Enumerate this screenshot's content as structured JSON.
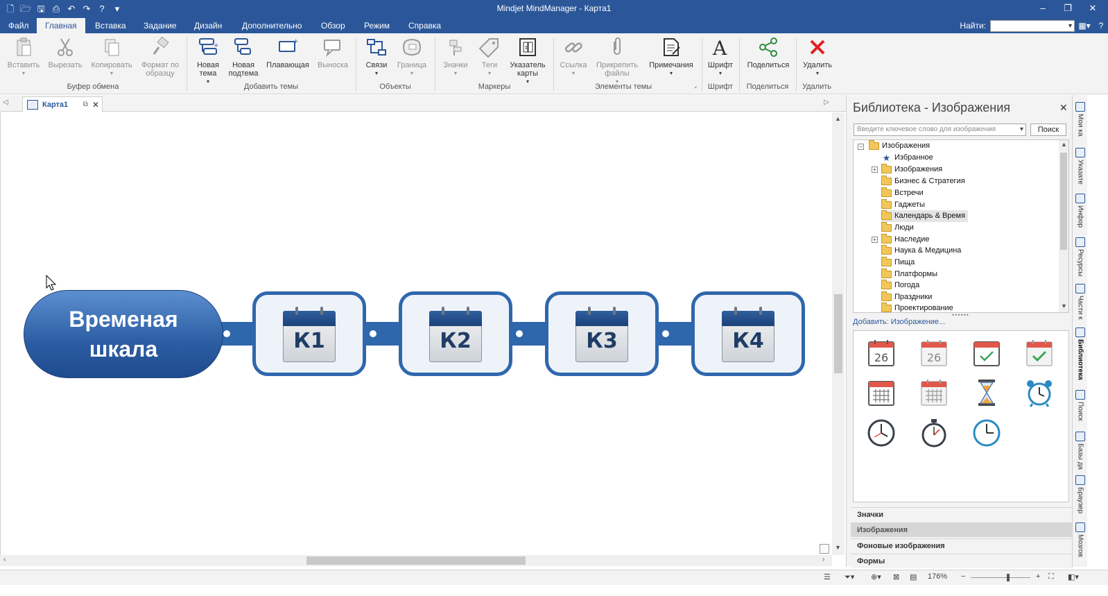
{
  "window": {
    "title": "Mindjet MindManager - Карта1",
    "qat_icons": [
      "new-doc-icon",
      "open-icon",
      "save-icon",
      "print-icon",
      "undo-icon",
      "redo-icon",
      "help-icon",
      "customize-icon"
    ]
  },
  "ribbon_tabs": [
    {
      "label": "Файл",
      "active": false
    },
    {
      "label": "Главная",
      "active": true
    },
    {
      "label": "Вставка",
      "active": false
    },
    {
      "label": "Задание",
      "active": false
    },
    {
      "label": "Дизайн",
      "active": false
    },
    {
      "label": "Дополнительно",
      "active": false
    },
    {
      "label": "Обзор",
      "active": false
    },
    {
      "label": "Режим",
      "active": false
    },
    {
      "label": "Справка",
      "active": false
    }
  ],
  "find": {
    "label": "Найти:",
    "value": ""
  },
  "ribbon": {
    "clipboard": {
      "label": "Буфер обмена",
      "paste": "Вставить",
      "cut": "Вырезать",
      "copy": "Копировать",
      "format_painter": "Формат по образцу"
    },
    "add_topics": {
      "label": "Добавить темы",
      "new_topic": "Новая тема",
      "new_subtopic": "Новая подтема",
      "floating": "Плавающая",
      "callout": "Выноска"
    },
    "objects": {
      "label": "Объекты",
      "relations": "Связи",
      "boundary": "Граница"
    },
    "markers": {
      "label": "Маркеры",
      "icons": "Значки",
      "tags": "Теги",
      "map_index": "Указатель карты"
    },
    "topic_elements": {
      "label": "Элементы темы",
      "link": "Ссылка",
      "attach": "Прикрепить файлы",
      "notes": "Примечания"
    },
    "font": {
      "label": "Шрифт",
      "font": "Шрифт"
    },
    "share": {
      "label": "Поделиться",
      "share": "Поделиться"
    },
    "delete": {
      "label": "Удалить",
      "delete": "Удалить"
    }
  },
  "doc_tab": {
    "label": "Карта1"
  },
  "map": {
    "central_topic": "Временая шкала",
    "subtopics": [
      "К1",
      "К2",
      "К3",
      "К4"
    ]
  },
  "panel": {
    "title": "Библиотека - Изображения",
    "search_placeholder": "Введите ключевое слово для изображения",
    "search_button": "Поиск",
    "tree": [
      {
        "label": "Изображения",
        "level": 0,
        "icon": "folder-open-icon",
        "expander": "⊟"
      },
      {
        "label": "Избранное",
        "level": 1,
        "icon": "star-icon",
        "expander": ""
      },
      {
        "label": "Изображения",
        "level": 1,
        "icon": "folder-icon",
        "expander": "⊞"
      },
      {
        "label": "Бизнес & Стратегия",
        "level": 1,
        "icon": "folder-icon",
        "expander": ""
      },
      {
        "label": "Встречи",
        "level": 1,
        "icon": "folder-icon",
        "expander": ""
      },
      {
        "label": "Гаджеты",
        "level": 1,
        "icon": "folder-icon",
        "expander": ""
      },
      {
        "label": "Календарь & Время",
        "level": 1,
        "icon": "folder-open-icon",
        "expander": "",
        "selected": true
      },
      {
        "label": "Люди",
        "level": 1,
        "icon": "folder-icon",
        "expander": ""
      },
      {
        "label": "Наследие",
        "level": 1,
        "icon": "folder-icon",
        "expander": "⊞"
      },
      {
        "label": "Наука & Медицина",
        "level": 1,
        "icon": "folder-icon",
        "expander": ""
      },
      {
        "label": "Пища",
        "level": 1,
        "icon": "folder-icon",
        "expander": ""
      },
      {
        "label": "Платформы",
        "level": 1,
        "icon": "folder-icon",
        "expander": ""
      },
      {
        "label": "Погода",
        "level": 1,
        "icon": "folder-icon",
        "expander": ""
      },
      {
        "label": "Праздники",
        "level": 1,
        "icon": "folder-icon",
        "expander": ""
      },
      {
        "label": "Проектирование",
        "level": 1,
        "icon": "folder-icon",
        "expander": ""
      }
    ],
    "add_link": "Добавить: Изображение...",
    "gallery": [
      {
        "icon": "calendar-day-icon",
        "text": "26"
      },
      {
        "icon": "calendar-day-light-icon",
        "text": "26"
      },
      {
        "icon": "calendar-check-icon",
        "text": ""
      },
      {
        "icon": "calendar-check-light-icon",
        "text": ""
      },
      {
        "icon": "calendar-grid-icon",
        "text": ""
      },
      {
        "icon": "calendar-grid-light-icon",
        "text": ""
      },
      {
        "icon": "hourglass-icon",
        "text": ""
      },
      {
        "icon": "alarm-clock-icon",
        "text": ""
      },
      {
        "icon": "clock-icon",
        "text": ""
      },
      {
        "icon": "stopwatch-icon",
        "text": ""
      },
      {
        "icon": "clock-blue-icon",
        "text": ""
      }
    ],
    "accordion": [
      {
        "label": "Значки",
        "active": false
      },
      {
        "label": "Изображения",
        "active": true
      },
      {
        "label": "Фоновые изображения",
        "active": false
      },
      {
        "label": "Формы",
        "active": false
      }
    ]
  },
  "side_tabs": [
    {
      "label": "Мои ка",
      "active": false
    },
    {
      "label": "Указате",
      "active": false
    },
    {
      "label": "Инфор",
      "active": false
    },
    {
      "label": "Ресурсы",
      "active": false
    },
    {
      "label": "Части к",
      "active": false
    },
    {
      "label": "Библиотека",
      "active": true
    },
    {
      "label": "Поиск",
      "active": false
    },
    {
      "label": "Базы да",
      "active": false
    },
    {
      "label": "Браузер",
      "active": false
    },
    {
      "label": "Мозгов",
      "active": false
    }
  ],
  "status": {
    "zoom": "176%"
  }
}
